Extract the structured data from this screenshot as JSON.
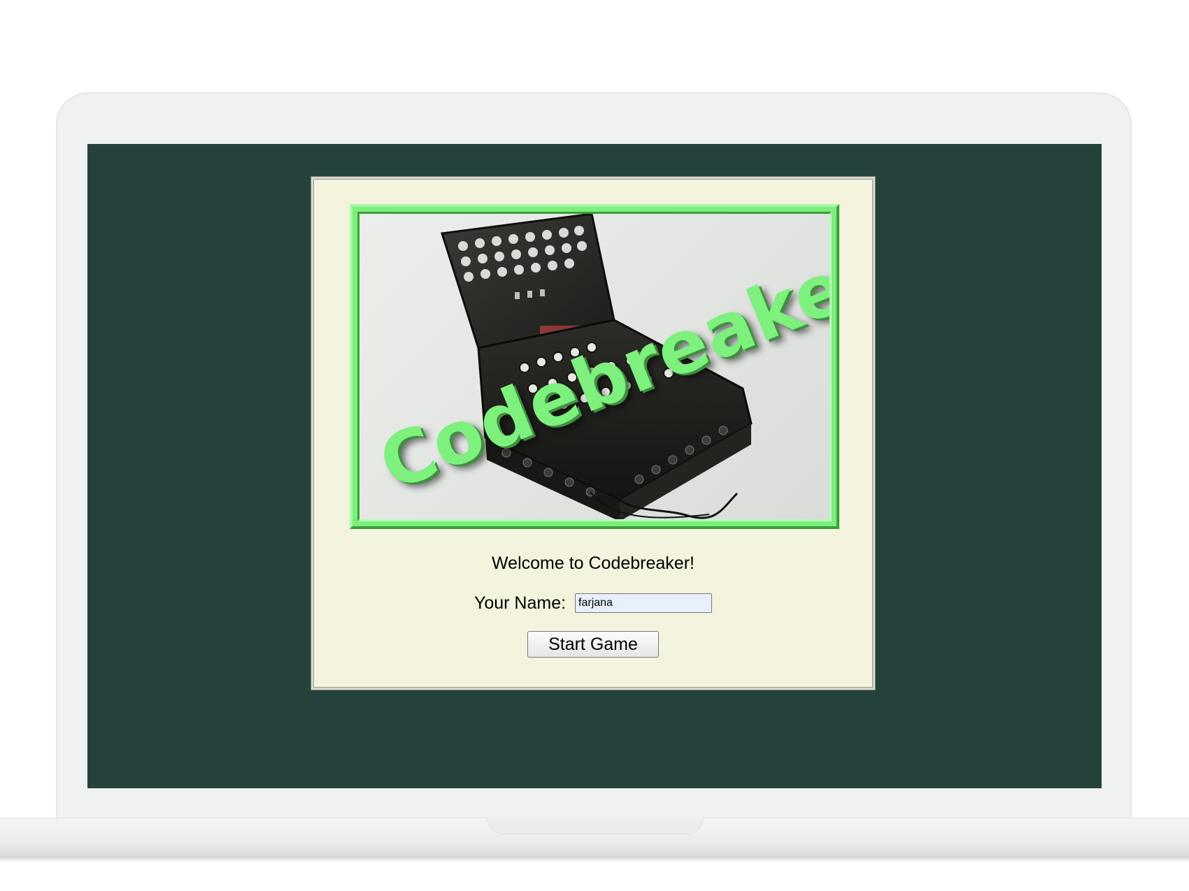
{
  "banner": {
    "title": "Codebreaker!",
    "image": "enigma-machine-photo"
  },
  "welcome_text": "Welcome to Codebreaker!",
  "name_field": {
    "label": "Your Name:",
    "value": "farjana"
  },
  "start_button": {
    "label": "Start Game"
  },
  "colors": {
    "screen_background": "#24423b",
    "panel_background": "#f3f3de",
    "banner_green": "#7cee7c"
  }
}
